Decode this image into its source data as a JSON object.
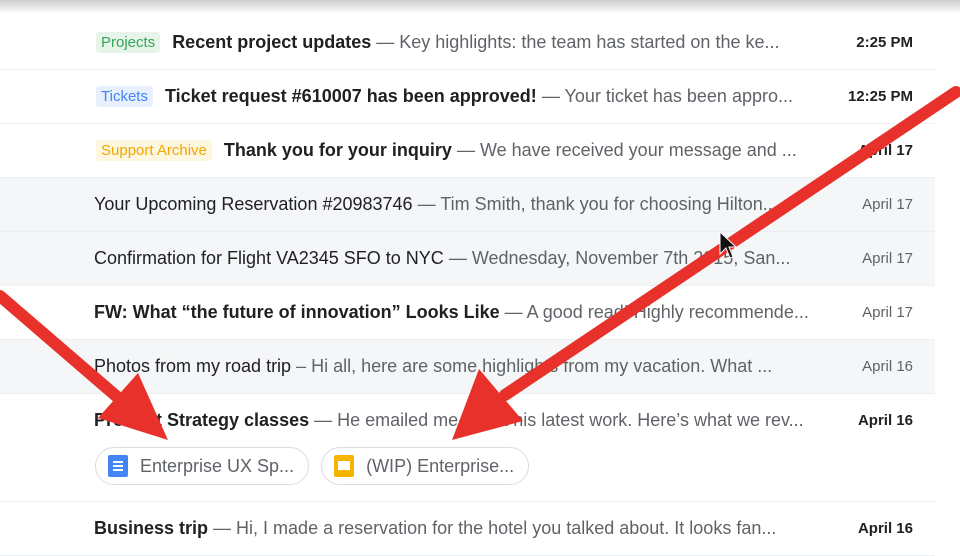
{
  "emails": [
    {
      "label": "Projects",
      "label_bg": "#e6f4ea",
      "label_fg": "#34a853",
      "subject": "Recent project updates",
      "snippet": "— Key highlights: the team has started on the ke...",
      "date": "2:25 PM",
      "unread": true
    },
    {
      "label": "Tickets",
      "label_bg": "#e8f0fe",
      "label_fg": "#4285f4",
      "subject": "Ticket request #610007 has been approved!",
      "snippet": "— Your ticket has been appro...",
      "date": "12:25 PM",
      "unread": true
    },
    {
      "label": "Support Archive",
      "label_bg": "#fef7e0",
      "label_fg": "#f2a600",
      "subject": "Thank you for your inquiry",
      "snippet": "— We have received your message and ...",
      "date": "April 17",
      "unread": true
    },
    {
      "label": "",
      "subject": "Your Upcoming Reservation #20983746",
      "snippet": "— Tim Smith, thank you for choosing Hilton...",
      "date": "April 17",
      "unread": false
    },
    {
      "label": "",
      "subject": "Confirmation for Flight VA2345 SFO to NYC",
      "snippet": "— Wednesday, November 7th 2015, San...",
      "date": "April 17",
      "unread": false
    },
    {
      "label": "",
      "subject": "FW: What “the future of innovation” Looks Like",
      "snippet": "— A good read! Highly recommende...",
      "date": "April 17",
      "unread": true
    },
    {
      "label": "",
      "subject": "Photos from my road trip",
      "snippet": "– Hi all, here are some highlights from my vacation. What ...",
      "date": "April 16",
      "unread": false
    },
    {
      "label": "",
      "subject": "Product Strategy classes",
      "snippet": "— He emailed me about his latest work. Here’s what we rev...",
      "date": "April 16",
      "unread": true
    },
    {
      "label": "",
      "subject": "Business trip",
      "snippet": "— Hi, I made a reservation for the hotel you talked about. It looks fan...",
      "date": "April 16",
      "unread": true
    }
  ],
  "attachments": [
    {
      "name": "Enterprise UX Sp...",
      "icon": "google-docs-icon"
    },
    {
      "name": "(WIP) Enterprise...",
      "icon": "google-slides-icon"
    }
  ],
  "colors": {
    "arrow": "#e8312a",
    "read_bg": "#f4f6f7"
  }
}
